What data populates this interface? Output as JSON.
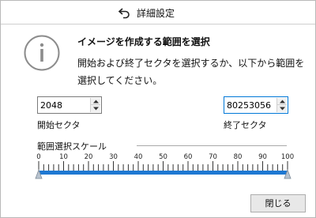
{
  "window": {
    "title": "詳細設定"
  },
  "info": {
    "heading": "イメージを作成する範囲を選択",
    "description": "開始および終了セクタを選択するか、以下から範囲を選択してください。"
  },
  "start_sector": {
    "value": "2048",
    "label": "開始セクタ"
  },
  "end_sector": {
    "value": "80253056",
    "label": "終了セクタ"
  },
  "scale": {
    "label": "範囲選択スケール",
    "ticks": [
      "0",
      "10",
      "20",
      "30",
      "40",
      "50",
      "60",
      "70",
      "80",
      "90",
      "100"
    ],
    "range_start_percent": 0,
    "range_end_percent": 100
  },
  "buttons": {
    "close": "閉じる"
  },
  "colors": {
    "accent": "#0078d7",
    "track": "#1e78d2"
  }
}
